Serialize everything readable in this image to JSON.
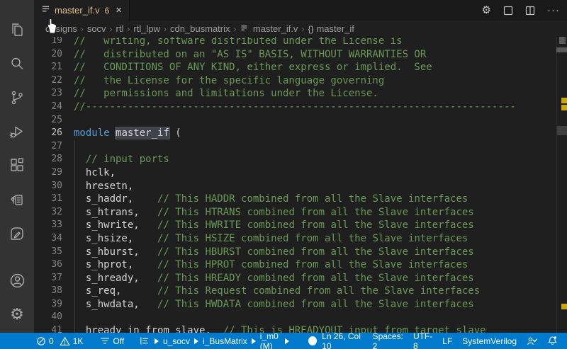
{
  "app": {
    "accent_color": "#007acc",
    "modified_tab_color": "#e2c08d",
    "keyword_color": "#569cd6",
    "comment_color": "#6a9955",
    "warning_mark_color": "#cca700"
  },
  "activity_bar": {
    "items": [
      "explorer",
      "search",
      "source-control",
      "run-and-debug",
      "extensions",
      "document-sync",
      "notebook-edit",
      "accounts",
      "settings-gear"
    ]
  },
  "tab_bar": {
    "tab": {
      "file_icon": "list-flat-icon",
      "label": "master_if.v",
      "badge": "6",
      "close_glyph": "×"
    },
    "actions": [
      "settings-gear",
      "layout-square",
      "split-editor",
      "more-actions"
    ],
    "more_glyph": "···",
    "gear_glyph": "⚙"
  },
  "breadcrumbs": {
    "separator": "›",
    "path": [
      "designs",
      "socv",
      "rtl",
      "rtl_lpw",
      "cdn_busmatrix"
    ],
    "file": {
      "icon": "list-flat-icon",
      "label": "master_if.v"
    },
    "symbol": {
      "icon_glyph": "{}",
      "label": "master_if"
    }
  },
  "editor": {
    "active_line": 26,
    "lines": [
      {
        "n": 19,
        "t": [
          [
            "c",
            "//   writing, software distributed under the License is"
          ]
        ]
      },
      {
        "n": 20,
        "t": [
          [
            "c",
            "//   distributed on an \"AS IS\" BASIS, WITHOUT WARRANTIES OR"
          ]
        ]
      },
      {
        "n": 21,
        "t": [
          [
            "c",
            "//   CONDITIONS OF ANY KIND, either express or implied.  See"
          ]
        ]
      },
      {
        "n": 22,
        "t": [
          [
            "c",
            "//   the License for the specific language governing"
          ]
        ]
      },
      {
        "n": 23,
        "t": [
          [
            "c",
            "//   permissions and limitations under the License."
          ]
        ]
      },
      {
        "n": 24,
        "t": [
          [
            "c",
            "//------------------------------------------------------------------------"
          ]
        ]
      },
      {
        "n": 25,
        "t": []
      },
      {
        "n": 26,
        "t": [
          [
            "k",
            "module"
          ],
          [
            "p",
            " "
          ],
          [
            "w",
            "master_if"
          ],
          [
            "p",
            " ("
          ]
        ]
      },
      {
        "n": 27,
        "t": []
      },
      {
        "n": 28,
        "t": [
          [
            "p",
            "  "
          ],
          [
            "c",
            "// input ports"
          ]
        ]
      },
      {
        "n": 29,
        "t": [
          [
            "p",
            "  hclk,"
          ]
        ]
      },
      {
        "n": 30,
        "t": [
          [
            "p",
            "  hresetn,"
          ]
        ]
      },
      {
        "n": 31,
        "t": [
          [
            "p",
            "  s_haddr,    "
          ],
          [
            "c",
            "// This HADDR combined from all the Slave interfaces"
          ]
        ]
      },
      {
        "n": 32,
        "t": [
          [
            "p",
            "  s_htrans,   "
          ],
          [
            "c",
            "// This HTRANS combined from all the Slave interfaces"
          ]
        ]
      },
      {
        "n": 33,
        "t": [
          [
            "p",
            "  s_hwrite,   "
          ],
          [
            "c",
            "// This HWRITE combined from all the Slave interfaces"
          ]
        ]
      },
      {
        "n": 34,
        "t": [
          [
            "p",
            "  s_hsize,    "
          ],
          [
            "c",
            "// This HSIZE combined from all the Slave interfaces"
          ]
        ]
      },
      {
        "n": 35,
        "t": [
          [
            "p",
            "  s_hburst,   "
          ],
          [
            "c",
            "// This HBURST combined from all the Slave interfaces"
          ]
        ]
      },
      {
        "n": 36,
        "t": [
          [
            "p",
            "  s_hprot,    "
          ],
          [
            "c",
            "// This HPROT combined from all the Slave interfaces"
          ]
        ]
      },
      {
        "n": 37,
        "t": [
          [
            "p",
            "  s_hready,   "
          ],
          [
            "c",
            "// This HREADY combined from all the Slave interfaces"
          ]
        ]
      },
      {
        "n": 38,
        "t": [
          [
            "p",
            "  s_req,      "
          ],
          [
            "c",
            "// This Request combined from all the Slave interfaces"
          ]
        ]
      },
      {
        "n": 39,
        "t": [
          [
            "p",
            "  s_hwdata,   "
          ],
          [
            "c",
            "// This HWDATA combined from all the Slave interfaces"
          ]
        ]
      },
      {
        "n": 40,
        "t": []
      },
      {
        "n": 41,
        "t": [
          [
            "p",
            "  hready_in_from_slave,  "
          ],
          [
            "c",
            "// This is HREADYOUT input from target slave"
          ]
        ]
      }
    ]
  },
  "status_bar": {
    "errors": "0",
    "warnings": "1K",
    "filter_label": "Off",
    "scope_items": [
      "u_socv",
      "i_BusMatrix",
      "i_m0 (M)"
    ],
    "cursor_position": "Ln 26, Col 10",
    "indentation": "Spaces: 2",
    "encoding": "UTF-8",
    "eol": "LF",
    "language": "SystemVerilog",
    "right_icons": [
      "feedback-person",
      "notifications-bell"
    ]
  }
}
